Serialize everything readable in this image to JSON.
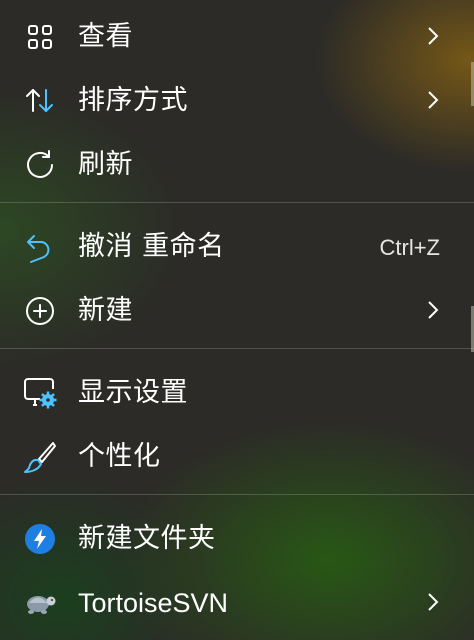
{
  "menu": {
    "items": [
      {
        "label": "查看",
        "icon": "grid-icon",
        "has_submenu": true
      },
      {
        "label": "排序方式",
        "icon": "sort-arrows-icon",
        "has_submenu": true
      },
      {
        "label": "刷新",
        "icon": "refresh-icon",
        "has_submenu": false
      },
      {
        "label": "撤消 重命名",
        "icon": "undo-icon",
        "shortcut": "Ctrl+Z",
        "has_submenu": false
      },
      {
        "label": "新建",
        "icon": "add-circle-icon",
        "has_submenu": true
      },
      {
        "label": "显示设置",
        "icon": "display-settings-icon",
        "has_submenu": false
      },
      {
        "label": "个性化",
        "icon": "brush-icon",
        "has_submenu": false
      },
      {
        "label": "新建文件夹",
        "icon": "lightning-icon",
        "has_submenu": false
      },
      {
        "label": "TortoiseSVN",
        "icon": "tortoise-icon",
        "has_submenu": true
      }
    ]
  },
  "colors": {
    "accent": "#4cc2ff",
    "text": "#ffffff",
    "badge_blue": "#1f7fe0"
  }
}
